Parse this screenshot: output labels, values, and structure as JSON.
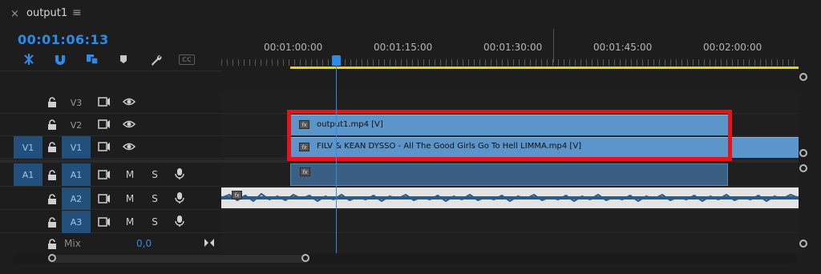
{
  "header": {
    "close_glyph": "×",
    "title": "output1",
    "menu_glyph": "≡"
  },
  "timecode": "00:01:06:13",
  "toolbar": {
    "icons": [
      "nest-sequence-icon",
      "snap-icon",
      "linked-selection-icon",
      "add-marker-icon",
      "wrench-icon",
      "captions-icon"
    ],
    "captions_label": "CC"
  },
  "ruler": {
    "labels": [
      "00:01:00:00",
      "00:01:15:00",
      "00:01:30:00",
      "00:01:45:00",
      "00:02:00:00"
    ]
  },
  "tracks": {
    "video": [
      {
        "name": "V3",
        "patch": ""
      },
      {
        "name": "V2",
        "patch": ""
      },
      {
        "name": "V1",
        "patch": "V1"
      }
    ],
    "audio": [
      {
        "name": "A1",
        "patch": "A1",
        "m": "M",
        "s": "S"
      },
      {
        "name": "A2",
        "patch": "",
        "m": "M",
        "s": "S"
      },
      {
        "name": "A3",
        "patch": "",
        "m": "M",
        "s": "S"
      }
    ],
    "mix_label": "Mix",
    "mix_value": "0,0"
  },
  "clips": {
    "v2_label": "output1.mp4 [V]",
    "v1_label": "FILV & KEAN DYSSO - All The Good Girls Go To Hell  LIMMA.mp4 [V]",
    "fx_label": "fx"
  },
  "colors": {
    "accent": "#2d8ceb",
    "clip_video": "#5b95c9",
    "clip_audio": "#3a5f82",
    "work_area": "#e5d700",
    "highlight": "#e8121b"
  }
}
